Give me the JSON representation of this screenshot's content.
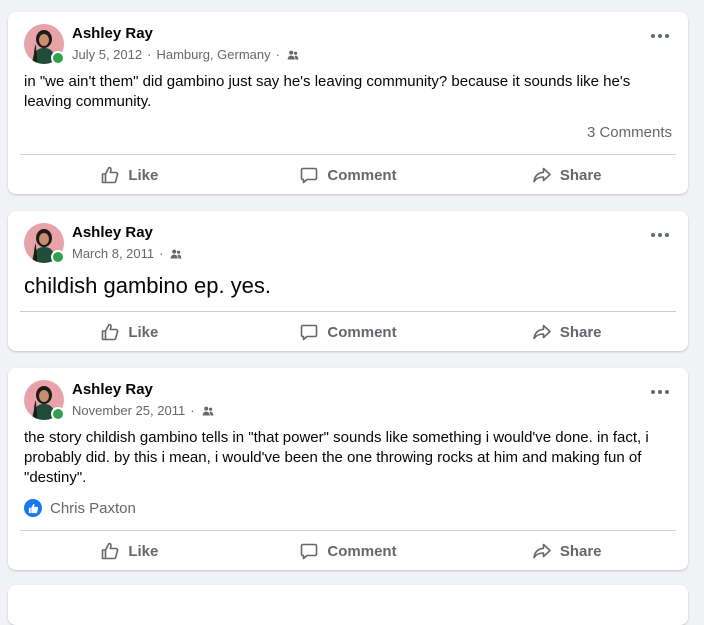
{
  "posts": [
    {
      "author": "Ashley Ray",
      "date": "July 5, 2012",
      "location": "Hamburg, Germany",
      "audience_icon": "friends-icon",
      "text": "in \"we ain't them\" did gambino just say he's leaving community? because it sounds like he's leaving community.",
      "comments": "3 Comments",
      "actions": {
        "like": "Like",
        "comment": "Comment",
        "share": "Share"
      }
    },
    {
      "author": "Ashley Ray",
      "date": "March 8, 2011",
      "audience_icon": "friends-icon",
      "text": "childish gambino ep. yes.",
      "actions": {
        "like": "Like",
        "comment": "Comment",
        "share": "Share"
      }
    },
    {
      "author": "Ashley Ray",
      "date": "November 25, 2011",
      "audience_icon": "friends-icon",
      "text": "the story childish gambino tells in \"that power\" sounds like something i would've done. in fact, i probably did. by this i mean, i would've been the one throwing rocks at him and making fun of \"destiny\".",
      "reaction_names": "Chris Paxton",
      "actions": {
        "like": "Like",
        "comment": "Comment",
        "share": "Share"
      }
    }
  ],
  "colors": {
    "background": "#f0f2f5",
    "card": "#ffffff",
    "secondary_text": "#65676b",
    "online": "#31a24c",
    "like_blue": "#1877f2"
  }
}
